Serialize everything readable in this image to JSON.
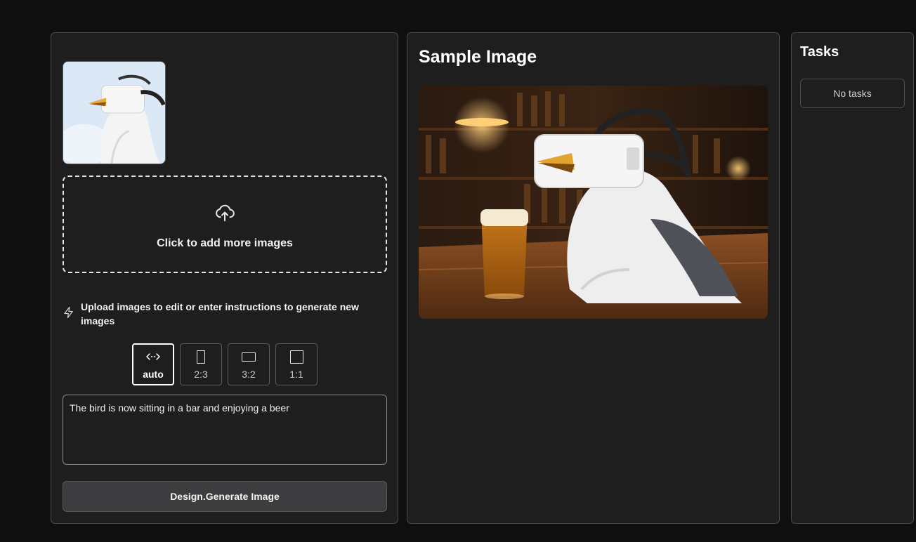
{
  "left": {
    "dropzone_label": "Click to add more images",
    "hint": "Upload images to edit or enter instructions to generate new images",
    "ratios": [
      {
        "label": "auto",
        "icon": "auto-arrows-icon",
        "active": true
      },
      {
        "label": "2:3",
        "icon": "portrait-ratio-icon",
        "active": false
      },
      {
        "label": "3:2",
        "icon": "landscape-ratio-icon",
        "active": false
      },
      {
        "label": "1:1",
        "icon": "square-ratio-icon",
        "active": false
      }
    ],
    "prompt_value": "The bird is now sitting in a bar and enjoying a beer",
    "generate_label": "Design.Generate Image"
  },
  "center": {
    "title": "Sample Image"
  },
  "right": {
    "title": "Tasks",
    "empty_label": "No tasks"
  },
  "colors": {
    "background": "#0f0f10",
    "panel": "#1e1e1f",
    "border": "#4a4a4c",
    "button": "#3d3d3f"
  }
}
